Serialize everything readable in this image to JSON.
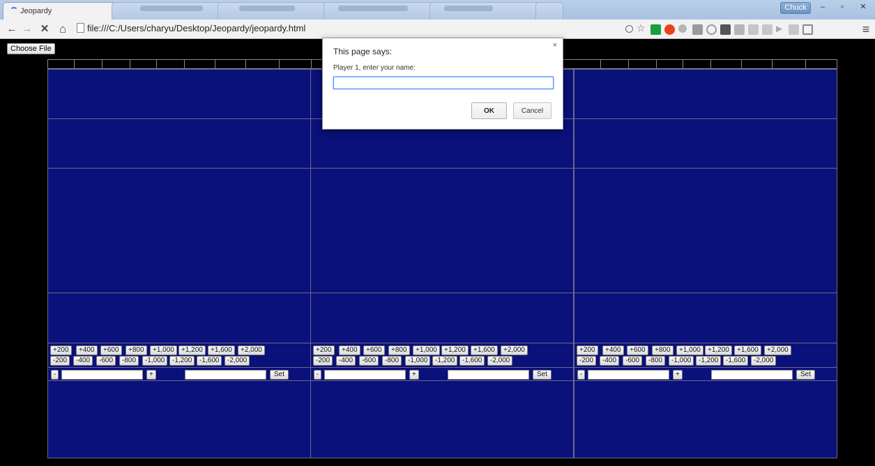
{
  "browser": {
    "tab_title": "Jeopardy",
    "tab_close": "×",
    "profile_name": "Chuck",
    "url": "file:///C:/Users/charyu/Desktop/Jeopardy/jeopardy.html",
    "nav": {
      "back": "←",
      "forward": "→",
      "stop": "✕",
      "home": "⌂",
      "menu": "≡"
    },
    "window": {
      "minimize": "–",
      "maximize": "▫",
      "close": "✕"
    }
  },
  "page": {
    "choose_file_label": "Choose File",
    "players": [
      {
        "plus_buttons": [
          "+200",
          "+400",
          "+600",
          "+800",
          "+1,000",
          "+1,200",
          "+1,600",
          "+2,000"
        ],
        "minus_buttons": [
          "-200",
          "-400",
          "-600",
          "-800",
          "-1,000",
          "-1,200",
          "-1,600",
          "-2,000"
        ],
        "dec_label": "-",
        "inc_label": "+",
        "set_label": "Set"
      },
      {
        "plus_buttons": [
          "+200",
          "+400",
          "+600",
          "+800",
          "+1,000",
          "+1,200",
          "+1,600",
          "+2,000"
        ],
        "minus_buttons": [
          "-200",
          "-400",
          "-600",
          "-800",
          "-1,000",
          "-1,200",
          "-1,600",
          "-2,000"
        ],
        "dec_label": "-",
        "inc_label": "+",
        "set_label": "Set"
      },
      {
        "plus_buttons": [
          "+200",
          "+400",
          "+600",
          "+800",
          "+1,000",
          "+1,200",
          "+1,600",
          "+2,000"
        ],
        "minus_buttons": [
          "-200",
          "-400",
          "-600",
          "-800",
          "-1,000",
          "-1,200",
          "-1,600",
          "-2,000"
        ],
        "dec_label": "-",
        "inc_label": "+",
        "set_label": "Set"
      }
    ]
  },
  "dialog": {
    "title": "This page says:",
    "close": "×",
    "message": "Player 1, enter your name:",
    "input_value": "",
    "ok_label": "OK",
    "cancel_label": "Cancel"
  },
  "colors": {
    "board_blue": "#0a117a",
    "page_bg": "#000000"
  }
}
